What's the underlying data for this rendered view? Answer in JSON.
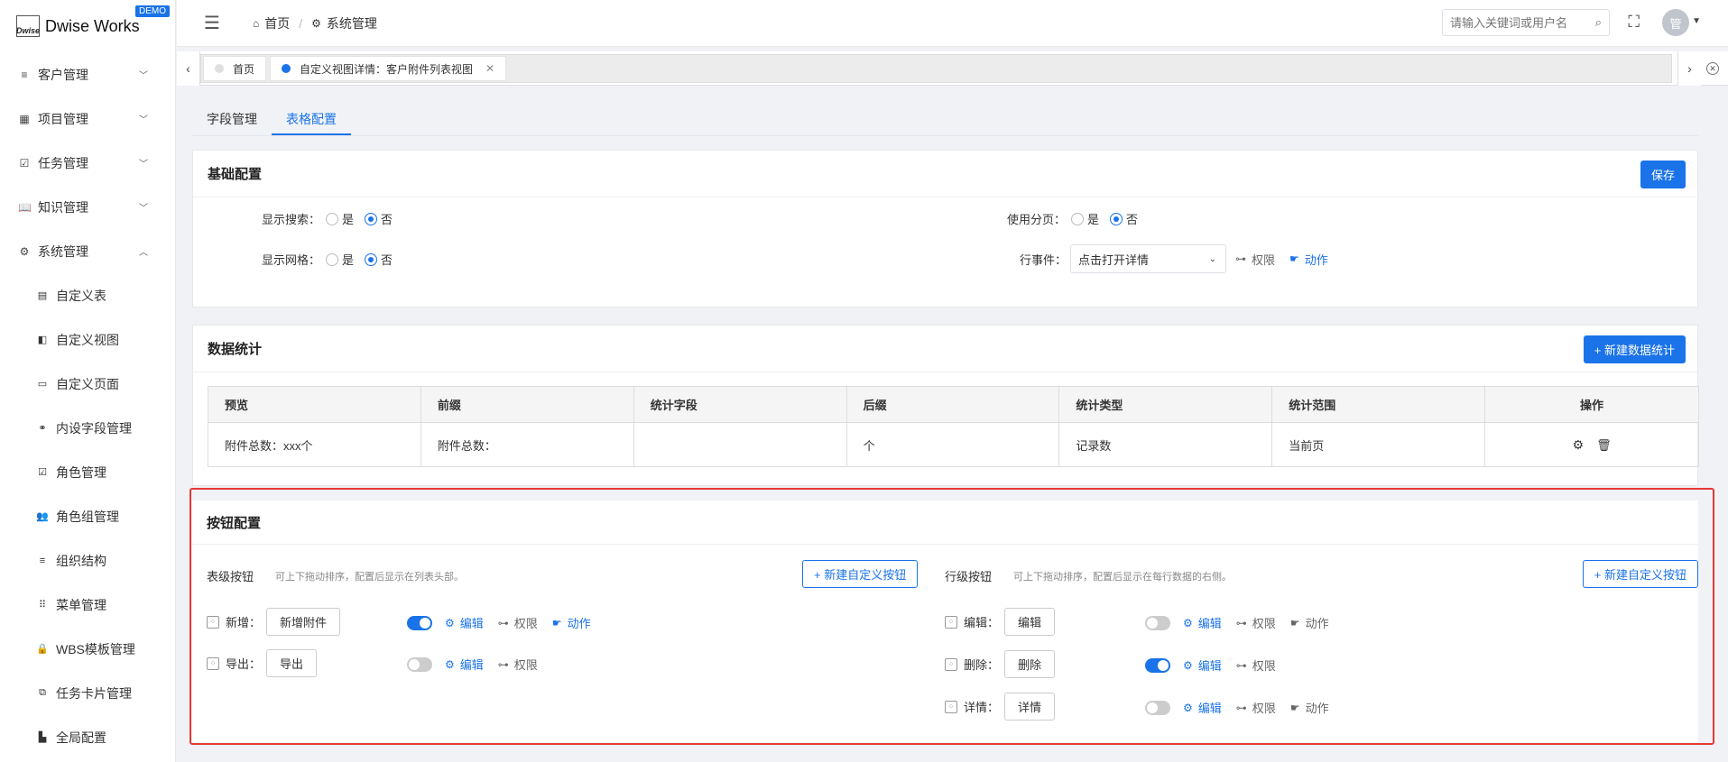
{
  "app": {
    "logo_mark": "Dwise",
    "title": "Dwise Works",
    "badge": "DEMO"
  },
  "sidebar": {
    "items": [
      {
        "label": "客户管理",
        "icon": "list-icon",
        "glyph": "≡",
        "expandable": true,
        "expanded": false
      },
      {
        "label": "项目管理",
        "icon": "grid-icon",
        "glyph": "▦",
        "expandable": true,
        "expanded": false
      },
      {
        "label": "任务管理",
        "icon": "task-icon",
        "glyph": "☑",
        "expandable": true,
        "expanded": false
      },
      {
        "label": "知识管理",
        "icon": "book-icon",
        "glyph": "📖",
        "expandable": true,
        "expanded": false
      },
      {
        "label": "系统管理",
        "icon": "gear-icon",
        "glyph": "⚙",
        "expandable": true,
        "expanded": true
      }
    ],
    "subitems": [
      {
        "label": "自定义表",
        "icon": "table-icon",
        "glyph": "▤"
      },
      {
        "label": "自定义视图",
        "icon": "view-icon",
        "glyph": "◧"
      },
      {
        "label": "自定义页面",
        "icon": "page-icon",
        "glyph": "▭"
      },
      {
        "label": "内设字段管理",
        "icon": "link-icon",
        "glyph": "⚭"
      },
      {
        "label": "角色管理",
        "icon": "check-icon",
        "glyph": "☑"
      },
      {
        "label": "角色组管理",
        "icon": "users-icon",
        "glyph": "👥"
      },
      {
        "label": "组织结构",
        "icon": "list-icon",
        "glyph": "≡"
      },
      {
        "label": "菜单管理",
        "icon": "dots-grid-icon",
        "glyph": "⠿"
      },
      {
        "label": "WBS模板管理",
        "icon": "lock-icon",
        "glyph": "🔒"
      },
      {
        "label": "任务卡片管理",
        "icon": "cards-icon",
        "glyph": "⧉"
      },
      {
        "label": "全局配置",
        "icon": "building-icon",
        "glyph": "▙"
      }
    ]
  },
  "header": {
    "breadcrumb": [
      {
        "label": "首页",
        "icon": "home-icon"
      },
      {
        "label": "系统管理",
        "icon": "gear-icon"
      }
    ],
    "search_placeholder": "请输入关键词或用户名",
    "avatar": "管"
  },
  "tabs": [
    {
      "label": "首页",
      "active": false,
      "dot_color": "#e0e0e0",
      "closable": false
    },
    {
      "label": "自定义视图详情：客户附件列表视图",
      "active": true,
      "dot_color": "#1a73e8",
      "closable": true
    }
  ],
  "subtabs": [
    {
      "label": "字段管理",
      "active": false
    },
    {
      "label": "表格配置",
      "active": true
    }
  ],
  "basic": {
    "title": "基础配置",
    "save": "保存",
    "show_search_label": "显示搜索：",
    "show_grid_label": "显示网格：",
    "paging_label": "使用分页：",
    "row_event_label": "行事件：",
    "yes": "是",
    "no": "否",
    "row_event_value": "点击打开详情",
    "perm": "权限",
    "action": "动作"
  },
  "stats": {
    "title": "数据统计",
    "new_button": "+ 新建数据统计",
    "columns": [
      "预览",
      "前缀",
      "统计字段",
      "后缀",
      "统计类型",
      "统计范围",
      "操作"
    ],
    "rows": [
      [
        "附件总数：xxx个",
        "附件总数：",
        "",
        "个",
        "记录数",
        "当前页"
      ]
    ]
  },
  "buttons": {
    "title": "按钮配置",
    "table_level": {
      "label": "表级按钮",
      "hint": "可上下拖动排序，配置后显示在列表头部。",
      "new_button": "+ 新建自定义按钮",
      "items": [
        {
          "name": "新增：",
          "button": "新增附件",
          "enabled": true,
          "edit": "编辑",
          "perm": "权限",
          "action": "动作"
        },
        {
          "name": "导出：",
          "button": "导出",
          "enabled": false,
          "edit": "编辑",
          "perm": "权限"
        }
      ]
    },
    "row_level": {
      "label": "行级按钮",
      "hint": "可上下拖动排序，配置后显示在每行数据的右侧。",
      "new_button": "+ 新建自定义按钮",
      "items": [
        {
          "name": "编辑：",
          "button": "编辑",
          "enabled": false,
          "edit": "编辑",
          "perm": "权限",
          "action": "动作"
        },
        {
          "name": "删除：",
          "button": "删除",
          "enabled": true,
          "edit": "编辑",
          "perm": "权限"
        },
        {
          "name": "详情：",
          "button": "详情",
          "enabled": false,
          "edit": "编辑",
          "perm": "权限",
          "action": "动作"
        }
      ]
    }
  },
  "colors": {
    "accent": "#1a73e8",
    "highlight": "#e53935"
  }
}
